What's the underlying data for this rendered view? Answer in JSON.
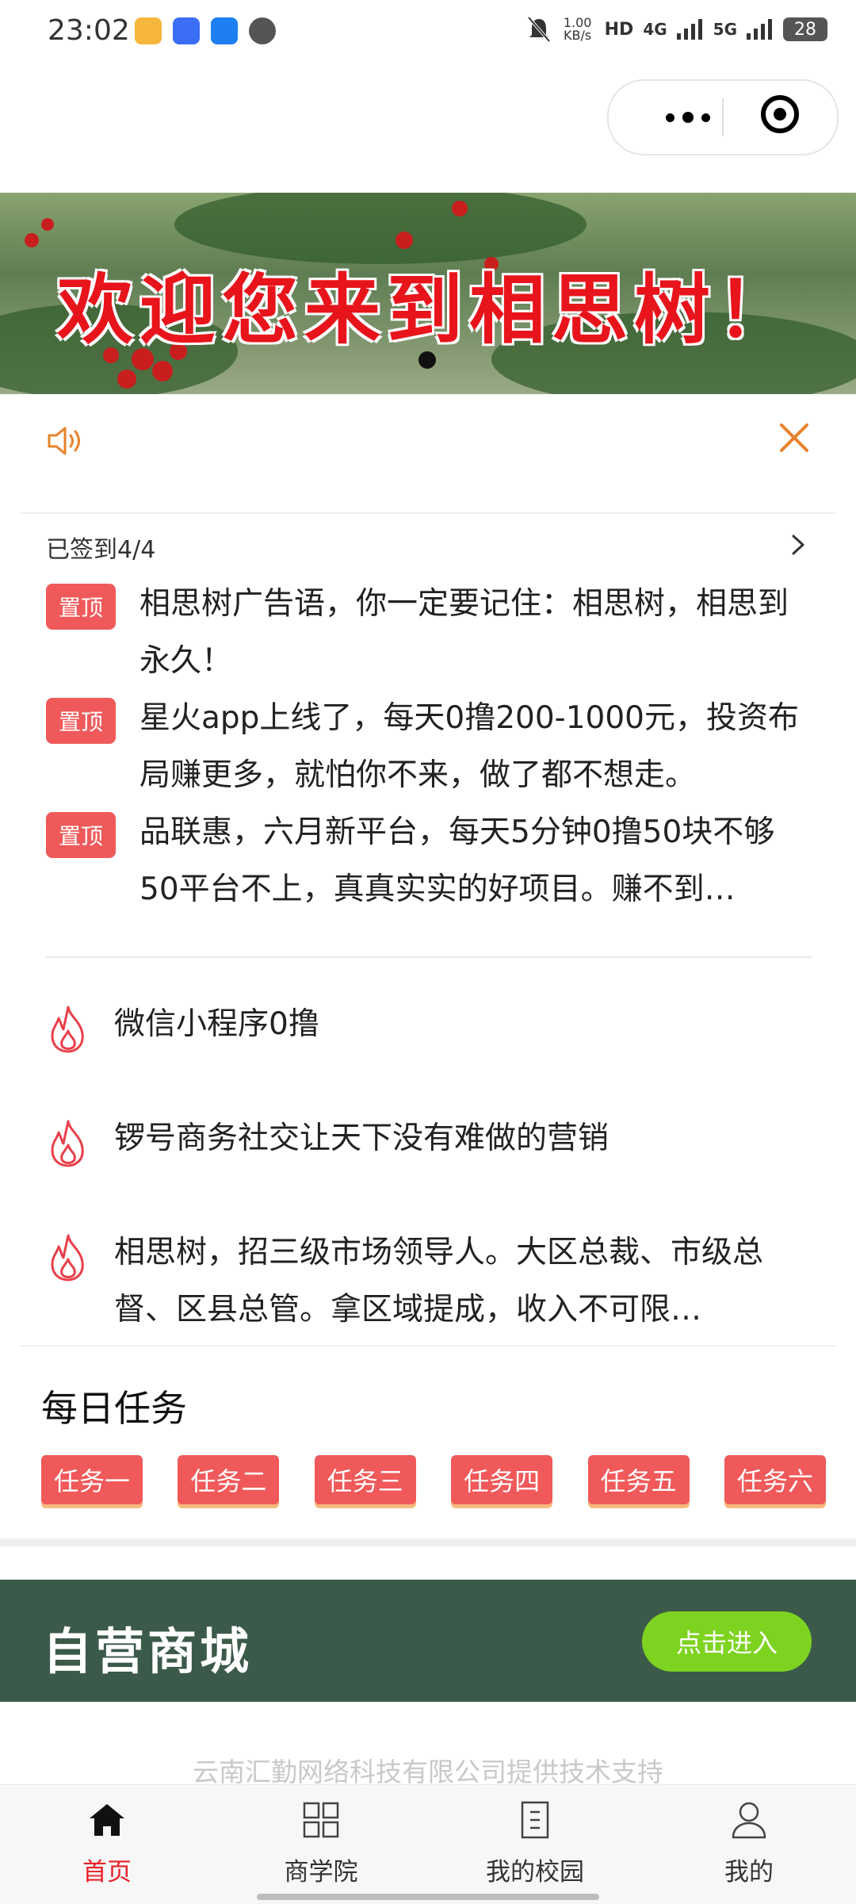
{
  "status_bar": {
    "time": "23:02",
    "net_speed": "1.00 KB/s",
    "signals": [
      "HD",
      "4G",
      "5G"
    ],
    "battery": "28"
  },
  "banner": {
    "title": "欢迎您来到相思树！"
  },
  "checkin": {
    "label": "已签到4/4"
  },
  "pinned_posts": [
    {
      "tag": "置顶",
      "text": "相思树广告语，你一定要记住：相思树，相思到永久！"
    },
    {
      "tag": "置顶",
      "text": "星火app上线了，每天0撸200-1000元，投资布局赚更多，就怕你不来，做了都不想走。"
    },
    {
      "tag": "置顶",
      "text": "品联惠，六月新平台，每天5分钟0撸50块不够50平台不上，真真实实的好项目。赚不到…"
    }
  ],
  "hot_posts": [
    {
      "text": "微信小程序0撸"
    },
    {
      "text": "锣号商务社交让天下没有难做的营销"
    },
    {
      "text": "相思树，招三级市场领导人。大区总裁、市级总督、区县总管。拿区域提成，收入不可限…"
    }
  ],
  "daily_tasks": {
    "title": "每日任务",
    "items": [
      "任务一",
      "任务二",
      "任务三",
      "任务四",
      "任务五",
      "任务六"
    ]
  },
  "mall": {
    "title": "自营商城",
    "button": "点击进入"
  },
  "footer": {
    "text": "云南汇勤网络科技有限公司提供技术支持"
  },
  "tabbar": {
    "items": [
      {
        "label": "首页",
        "icon": "home-icon",
        "active": true
      },
      {
        "label": "商学院",
        "icon": "grid-icon",
        "active": false
      },
      {
        "label": "我的校园",
        "icon": "document-icon",
        "active": false
      },
      {
        "label": "我的",
        "icon": "user-icon",
        "active": false
      }
    ]
  },
  "colors": {
    "accent_red": "#f0595a",
    "active_tab": "#e8202a",
    "mall_bg": "#3c5a4a",
    "mall_button": "#7ed321",
    "notice_orange": "#e8822a"
  }
}
